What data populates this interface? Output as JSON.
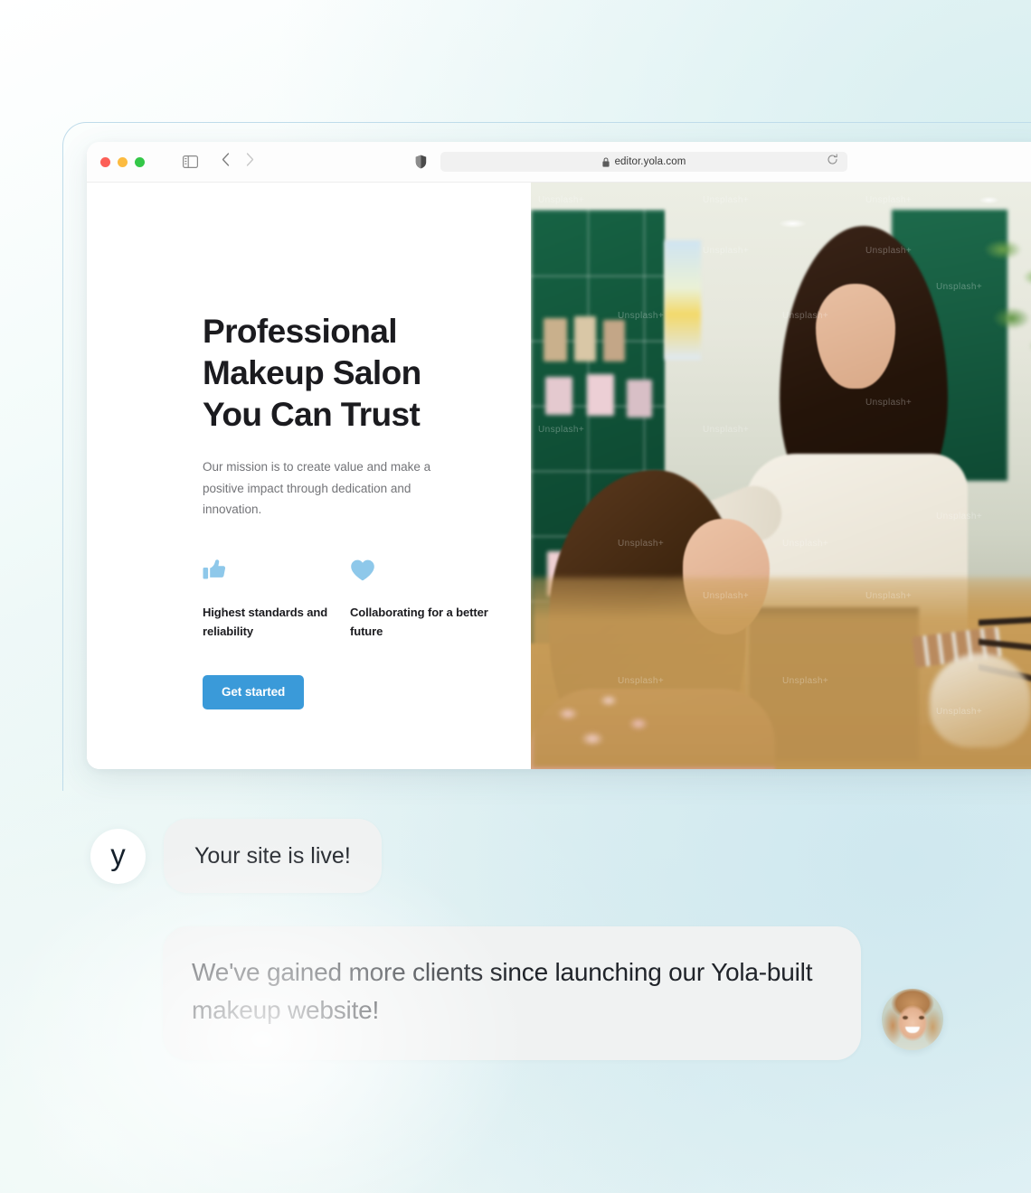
{
  "browser": {
    "traffic_lights": [
      "close",
      "minimize",
      "zoom"
    ],
    "sidebar_icon": "sidebar-icon",
    "back_icon": "chevron-left-icon",
    "forward_icon": "chevron-right-icon",
    "shield_icon": "shield-icon",
    "lock_icon": "lock-icon",
    "url": "editor.yola.com",
    "reload_icon": "reload-icon"
  },
  "site": {
    "hero": {
      "title": "Professional Makeup Salon You Can Trust",
      "subtitle": "Our mission is to create value and make a positive impact through dedication and innovation.",
      "cta_label": "Get started"
    },
    "features": [
      {
        "icon": "thumbs-up-icon",
        "label": "Highest standards and reliability"
      },
      {
        "icon": "heart-icon",
        "label": "Collaborating for a better future"
      }
    ],
    "photo": {
      "alt": "Makeup artist applying makeup to a client in a salon",
      "watermark": "Unsplash+"
    }
  },
  "chat": {
    "brand_mark": "y",
    "messages": [
      {
        "from": "yola",
        "text": "Your site is live!"
      },
      {
        "from": "customer",
        "text": "We've gained more clients since launching our Yola-built makeup website!"
      }
    ]
  },
  "colors": {
    "accent_blue": "#3a9ad9",
    "icon_blue": "#8ec8ea",
    "heading": "#1b1b1f",
    "body_text": "#737478",
    "bubble_bg": "#f0f2f2",
    "frame_border": "#bfdcea"
  }
}
